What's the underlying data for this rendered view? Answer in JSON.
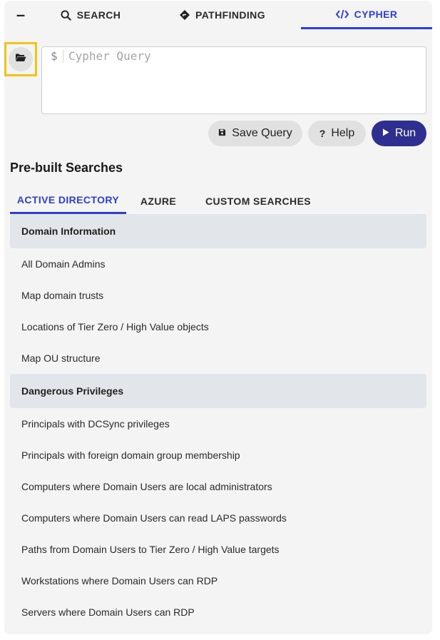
{
  "tabs": {
    "collapse": "–",
    "search": "SEARCH",
    "pathfinding": "PATHFINDING",
    "cypher": "CYPHER"
  },
  "query": {
    "prompt": "$",
    "placeholder": "Cypher Query"
  },
  "buttons": {
    "save": "Save Query",
    "help": "Help",
    "help_glyph": "?",
    "run": "Run"
  },
  "prebuilt": {
    "title": "Pre-built Searches",
    "tabs": [
      "ACTIVE DIRECTORY",
      "AZURE",
      "CUSTOM SEARCHES"
    ],
    "groups": [
      {
        "header": "Domain Information",
        "items": [
          "All Domain Admins",
          "Map domain trusts",
          "Locations of Tier Zero / High Value objects",
          "Map OU structure"
        ]
      },
      {
        "header": "Dangerous Privileges",
        "items": [
          "Principals with DCSync privileges",
          "Principals with foreign domain group membership",
          "Computers where Domain Users are local administrators",
          "Computers where Domain Users can read LAPS passwords",
          "Paths from Domain Users to Tier Zero / High Value targets",
          "Workstations where Domain Users can RDP",
          "Servers where Domain Users can RDP"
        ]
      }
    ]
  },
  "colors": {
    "accent": "#2d3fd6",
    "run_button": "#2f2f8f",
    "highlight": "#f2c419",
    "panel": "#f4f4f4"
  },
  "icons": [
    "search-icon",
    "pathfinding-icon",
    "code-icon",
    "folder-open-icon",
    "save-icon",
    "play-icon"
  ]
}
